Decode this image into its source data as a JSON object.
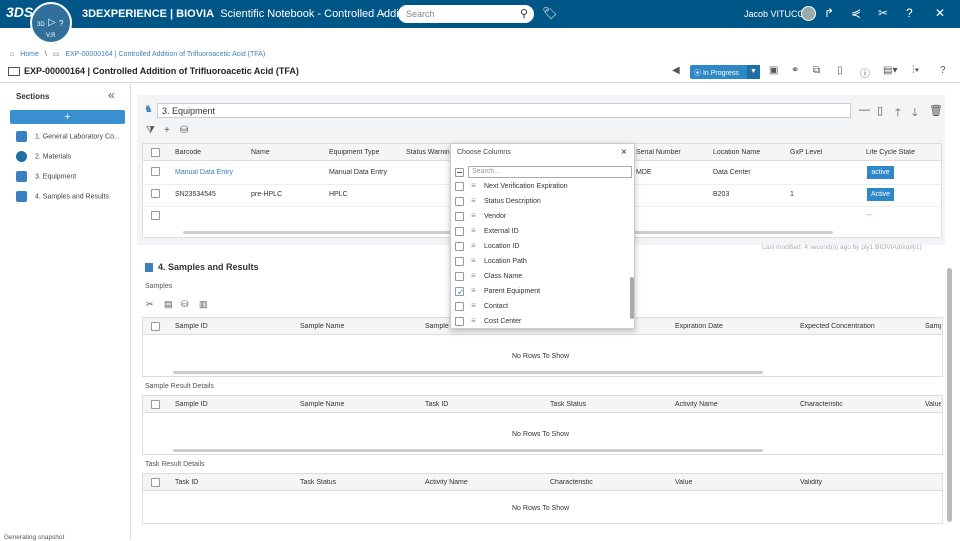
{
  "topbar": {
    "ds_logo": "3DS",
    "compass": {
      "label_3d": "3D",
      "label_vr": "V,R",
      "play_icon": "play-icon"
    },
    "brand_prefix": "3DEXPERIENCE | BIOVIA",
    "brand_app": "Scientific Notebook - Controlled Additi...",
    "search_placeholder": "Search",
    "user": "Jacob VITUCCI",
    "color": "#005686"
  },
  "breadcrumb": {
    "home": "Home",
    "sep": "\\",
    "exp": "EXP-00000164 | Controlled Addition of Trifluoroacetic Acid (TFA)"
  },
  "page_title": "EXP-00000164 | Controlled Addition of Trifluoroacetic Acid (TFA)",
  "toolbar": {
    "status": "In Progress"
  },
  "sidebar": {
    "header": "Sections",
    "add_label": "+",
    "items": [
      {
        "label": "1. General Laboratory Co...",
        "icon": "notebook-icon",
        "color": "#3a7fc0"
      },
      {
        "label": "2. Materials",
        "icon": "materials-icon",
        "color": "#1f6fa5"
      },
      {
        "label": "3. Equipment",
        "icon": "equipment-icon",
        "color": "#3a7fc0"
      },
      {
        "label": "4. Samples and Results",
        "icon": "samples-icon",
        "color": "#3a7fc0"
      }
    ]
  },
  "equipment": {
    "title": "3. Equipment",
    "columns": [
      "Barcode",
      "Name",
      "Equipment Type",
      "Status Warning",
      "Serial Number",
      "Location Name",
      "GxP Level",
      "Life Cycle State"
    ],
    "rows": [
      {
        "barcode": "Manual Data Entry",
        "name": "",
        "type": "Manual Data Entry",
        "serial": "MDE",
        "location": "Data Center",
        "gxp": "",
        "state": "active"
      },
      {
        "barcode": "SN23534545",
        "name": "pre-HPLC",
        "type": "HPLC",
        "serial": "",
        "location": "B203",
        "gxp": "1",
        "state": "Active"
      },
      {
        "barcode": "",
        "name": "",
        "type": "",
        "serial": "",
        "location": "",
        "gxp": "",
        "state": "--"
      }
    ],
    "last_modified": "Last modified: 4 second(s) ago by ply1 BIOVIA(bioply1)"
  },
  "samples_section": {
    "title": "4. Samples and Results",
    "samples_label": "Samples",
    "samples_columns": [
      "Sample ID",
      "Sample Name",
      "Sample",
      "Expiration Date",
      "Expected Concentration",
      "Samp"
    ],
    "samples_empty": "No Rows To Show",
    "result_label": "Sample Result Details",
    "result_columns": [
      "Sample ID",
      "Sample Name",
      "Task ID",
      "Task Status",
      "Activity Name",
      "Characteristic",
      "Value"
    ],
    "result_empty": "No Rows To Show",
    "task_label": "Task Result Details",
    "task_columns": [
      "Task ID",
      "Task Status",
      "Activity Name",
      "Characteristic",
      "Value",
      "Validity"
    ],
    "task_empty": "No Rows To Show"
  },
  "choose_columns": {
    "title": "Choose Columns",
    "close": "×",
    "search_placeholder": "Search...",
    "items": [
      {
        "label": "Next Verification Expiration",
        "checked": false
      },
      {
        "label": "Status Description",
        "checked": false
      },
      {
        "label": "Vendor",
        "checked": false
      },
      {
        "label": "External ID",
        "checked": false
      },
      {
        "label": "Location ID",
        "checked": false
      },
      {
        "label": "Location Path",
        "checked": false
      },
      {
        "label": "Class Name",
        "checked": false
      },
      {
        "label": "Parent Equipment",
        "checked": true
      },
      {
        "label": "Contact",
        "checked": false
      },
      {
        "label": "Cost Center",
        "checked": false
      }
    ]
  },
  "status_bar": "Generating snapshot"
}
